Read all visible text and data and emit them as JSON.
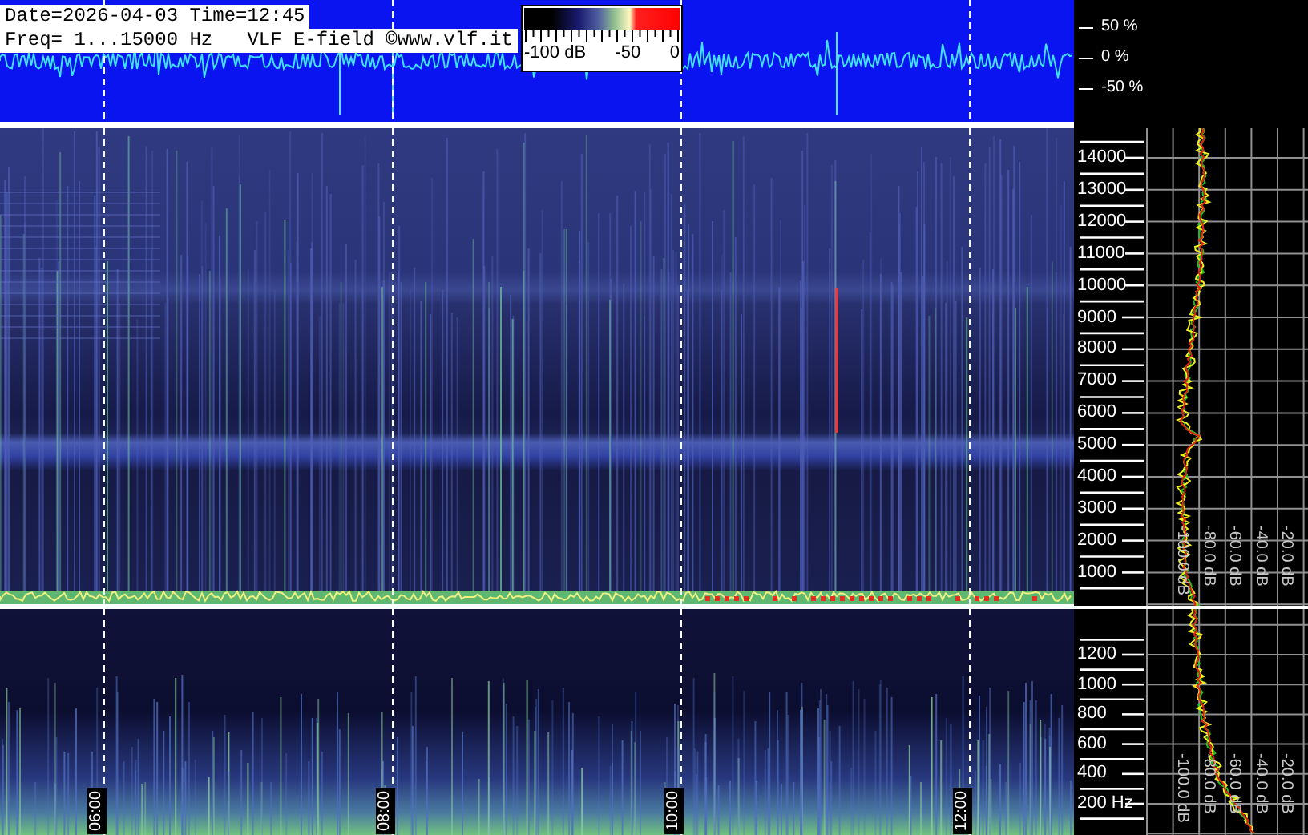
{
  "waveform_panel": {
    "info_lines": [
      "Date=2026-04-03 Time=12:45",
      "Freq= 1...15000 Hz   VLF E-field ©www.vlf.it"
    ],
    "color_scale_labels": [
      "-100 dB",
      "-50",
      "0"
    ],
    "amplitude_labels": [
      "50 %",
      "0 %",
      "-50 %"
    ]
  },
  "spectrogram": {
    "time_labels": [
      "06:00",
      "08:00",
      "10:00",
      "12:00"
    ]
  },
  "upper_spectrum": {
    "frequency_labels": [
      "14000",
      "13000",
      "12000",
      "11000",
      "10000",
      "9000",
      "8000",
      "7000",
      "6000",
      "5000",
      "4000",
      "3000",
      "2000",
      "1000"
    ],
    "db_labels": [
      "-100.0 dB",
      "-80.0 dB",
      "-60.0 dB",
      "-40.0 dB",
      "-20.0 dB"
    ]
  },
  "lower_spectrum": {
    "frequency_labels": [
      "1200",
      "1000",
      "800",
      "600",
      "400",
      "200 Hz"
    ],
    "db_labels": [
      "-100.0 dB",
      "-80.0 dB",
      "-60.0 dB",
      "-40.0 dB",
      "-20.0 dB"
    ]
  }
}
